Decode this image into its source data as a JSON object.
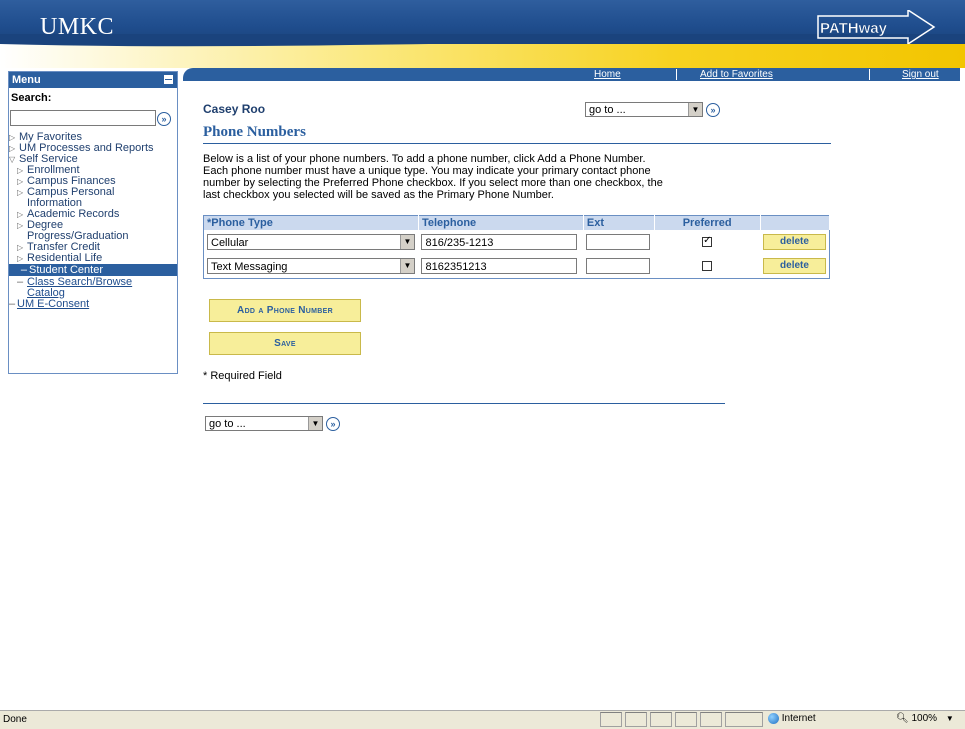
{
  "header": {
    "logo_text": "UMKC",
    "brand_text": "PATHway"
  },
  "topnav": {
    "home": "Home",
    "favorites": "Add to Favorites",
    "signout": "Sign out"
  },
  "menu": {
    "title": "Menu",
    "search_label": "Search:",
    "search_value": "",
    "items": [
      {
        "label": "My Favorites"
      },
      {
        "label": "UM Processes and Reports"
      },
      {
        "label": "Self Service"
      },
      {
        "label": "Enrollment"
      },
      {
        "label": "Campus Finances"
      },
      {
        "label": "Campus Personal"
      },
      {
        "label": "Information"
      },
      {
        "label": "Academic Records"
      },
      {
        "label": "Degree"
      },
      {
        "label": "Progress/Graduation"
      },
      {
        "label": "Transfer Credit"
      },
      {
        "label": "Residential Life"
      },
      {
        "label": "Student Center"
      },
      {
        "label": "Class Search/Browse"
      },
      {
        "label": "Catalog"
      },
      {
        "label": "UM E-Consent"
      }
    ]
  },
  "page": {
    "user_name": "Casey Roo",
    "goto_label": "go to ...",
    "title": "Phone Numbers",
    "intro": "Below is a list of your phone numbers. To add a phone number, click Add a Phone Number. Each phone number must have a unique type. You may indicate your primary contact phone number by selecting the Preferred Phone checkbox. If you select more than one checkbox, the last checkbox you selected will be saved as the Primary Phone Number.",
    "intro_lines": [
      "Below is a list of your phone numbers. To add a phone number, click Add a Phone Number.",
      "Each phone number must have a unique type. You may indicate your primary contact phone",
      "number by selecting the Preferred Phone checkbox. If you select more than one checkbox, the",
      "last checkbox you selected will be saved as the Primary Phone Number."
    ]
  },
  "table": {
    "headers": {
      "type": "*Phone Type",
      "telephone": "Telephone",
      "ext": "Ext",
      "preferred": "Preferred"
    },
    "rows": [
      {
        "type": "Cellular",
        "telephone": "816/235-1213",
        "ext": "",
        "preferred": true,
        "delete": "delete"
      },
      {
        "type": "Text Messaging",
        "telephone": "8162351213",
        "ext": "",
        "preferred": false,
        "delete": "delete"
      }
    ]
  },
  "actions": {
    "add": "Add a Phone Number",
    "save": "Save",
    "required_note": "* Required Field"
  },
  "statusbar": {
    "text": "Done",
    "zone": "Internet",
    "zoom": "100%"
  }
}
